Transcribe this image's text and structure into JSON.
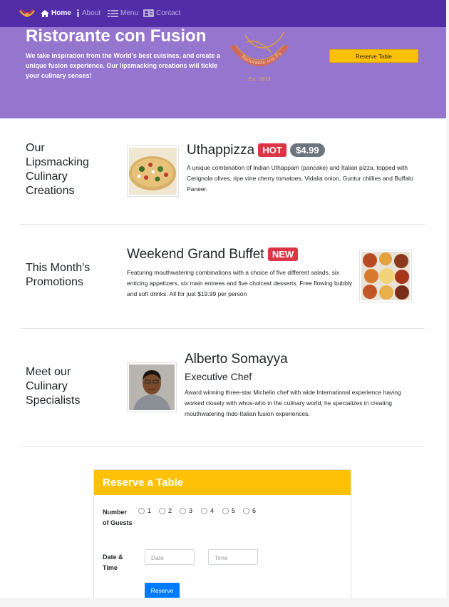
{
  "navbar": {
    "items": [
      {
        "label": "Home",
        "icon": "home-icon"
      },
      {
        "label": "About",
        "icon": "info-icon"
      },
      {
        "label": "Menu",
        "icon": "list-icon"
      },
      {
        "label": "Contact",
        "icon": "address-card-icon"
      }
    ]
  },
  "jumbotron": {
    "title": "Ristorante con Fusion",
    "description": "We take inspiration from the World's best cuisines, and create a unique fusion experience. Our lipsmacking creations will tickle your culinary senses!",
    "logo_text": "Ristorante con Fusion",
    "logo_est": "Est. 2013",
    "reserve_button": "Reserve Table"
  },
  "sections": {
    "creations": {
      "heading": "Our Lipsmacking Culinary Creations",
      "title": "Uthappizza",
      "badge": "HOT",
      "price": "$4.99",
      "text": "A unique combination of Indian Uthappam (pancake) and Italian pizza, topped with Cerignola olives, ripe vine cherry tomatoes, Vidalia onion, Guntur chillies and Buffalo Paneer."
    },
    "promotions": {
      "heading": "This Month's Promotions",
      "title": "Weekend Grand Buffet",
      "badge": "NEW",
      "text": "Featuring mouthwatering combinations with a choice of five different salads, six enticing appetizers, six main entrees and five choicest desserts. Free flowing bubbly and soft drinks. All for just $19.99 per person"
    },
    "specialists": {
      "heading": "Meet our Culinary Specialists",
      "title": "Alberto Somayya",
      "subtitle": "Executive Chef",
      "text": "Award winning three-star Michelin chef with wide International experience having worked closely with whos-who in the culinary world, he specializes in creating mouthwatering Indo-Italian fusion experiences."
    }
  },
  "reservation": {
    "header": "Reserve a Table",
    "guests_label": "Number of Guests",
    "guest_options": [
      "1",
      "2",
      "3",
      "4",
      "5",
      "6"
    ],
    "datetime_label": "Date & Time",
    "date_placeholder": "Date",
    "time_placeholder": "Time",
    "submit": "Reserve"
  },
  "colors": {
    "navbar": "#512da8",
    "jumbotron": "#9575cd",
    "accent": "#ffc107",
    "badge_danger": "#dc3545",
    "badge_price": "#6c757d",
    "primary": "#007bff"
  }
}
